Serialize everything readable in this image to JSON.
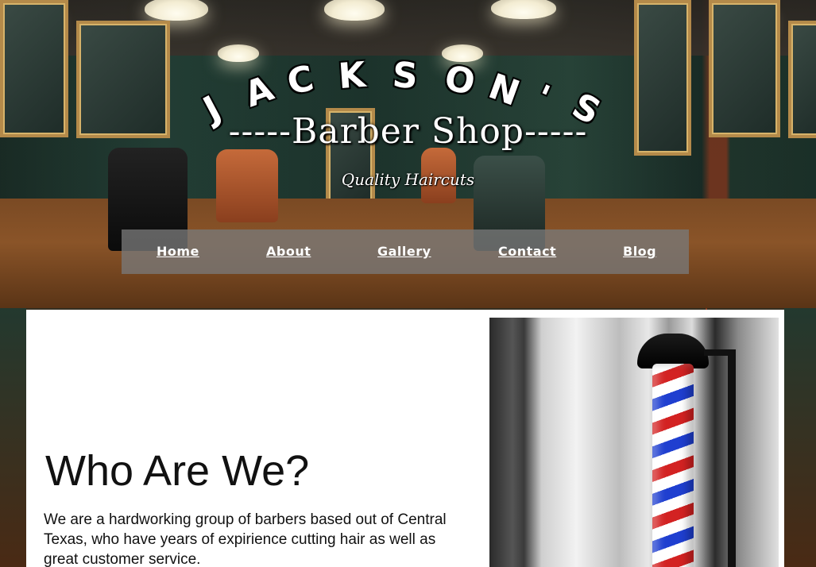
{
  "brand": {
    "arc_letters": [
      "J",
      "A",
      "C",
      "K",
      "S",
      "O",
      "N",
      "'",
      "S"
    ],
    "title": "-----Barber Shop-----",
    "tagline": "Quality Haircuts"
  },
  "nav": {
    "items": [
      {
        "label": "Home"
      },
      {
        "label": "About"
      },
      {
        "label": "Gallery"
      },
      {
        "label": "Contact"
      },
      {
        "label": "Blog"
      }
    ]
  },
  "about": {
    "heading": "Who Are We?",
    "text": "We are a hardworking group of barbers based out of Central Texas, who have years of expirience cutting hair as well as great customer service."
  },
  "colors": {
    "nav_bg": "#787878",
    "text_dark": "#111111",
    "pole_red": "#d32222",
    "pole_blue": "#1f3fd0"
  }
}
